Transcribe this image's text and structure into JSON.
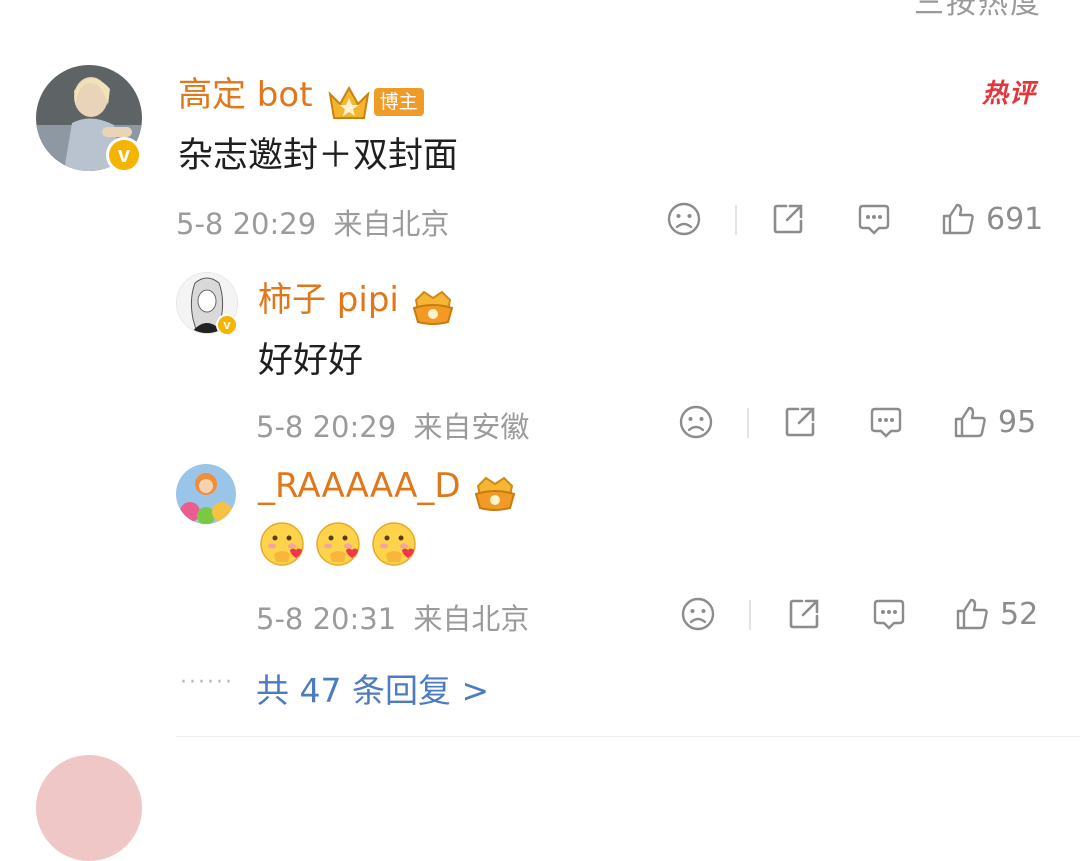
{
  "header": {
    "sort_label": "按热度"
  },
  "main_comment": {
    "username": "高定 bot",
    "blogger_tag": "博主",
    "hot_label": "热评",
    "text": "杂志邀封＋双封面",
    "time": "5-8 20:29",
    "location": "来自北京",
    "likes": "691"
  },
  "replies": [
    {
      "username": "柿子 pipi",
      "text": "好好好",
      "time": "5-8 20:29",
      "location": "来自安徽",
      "likes": "95"
    },
    {
      "username": "_RAAAAA_D",
      "emojis": [
        "heart-hands-emoji",
        "heart-hands-emoji",
        "heart-hands-emoji"
      ],
      "time": "5-8 20:31",
      "location": "来自北京",
      "likes": "52"
    }
  ],
  "more_replies": {
    "dots": "······",
    "label": "共 47 条回复 >"
  },
  "colors": {
    "username": "#e0781b",
    "link": "#4d7bbf",
    "hot": "#e8333a",
    "badge": "#f5b400"
  }
}
